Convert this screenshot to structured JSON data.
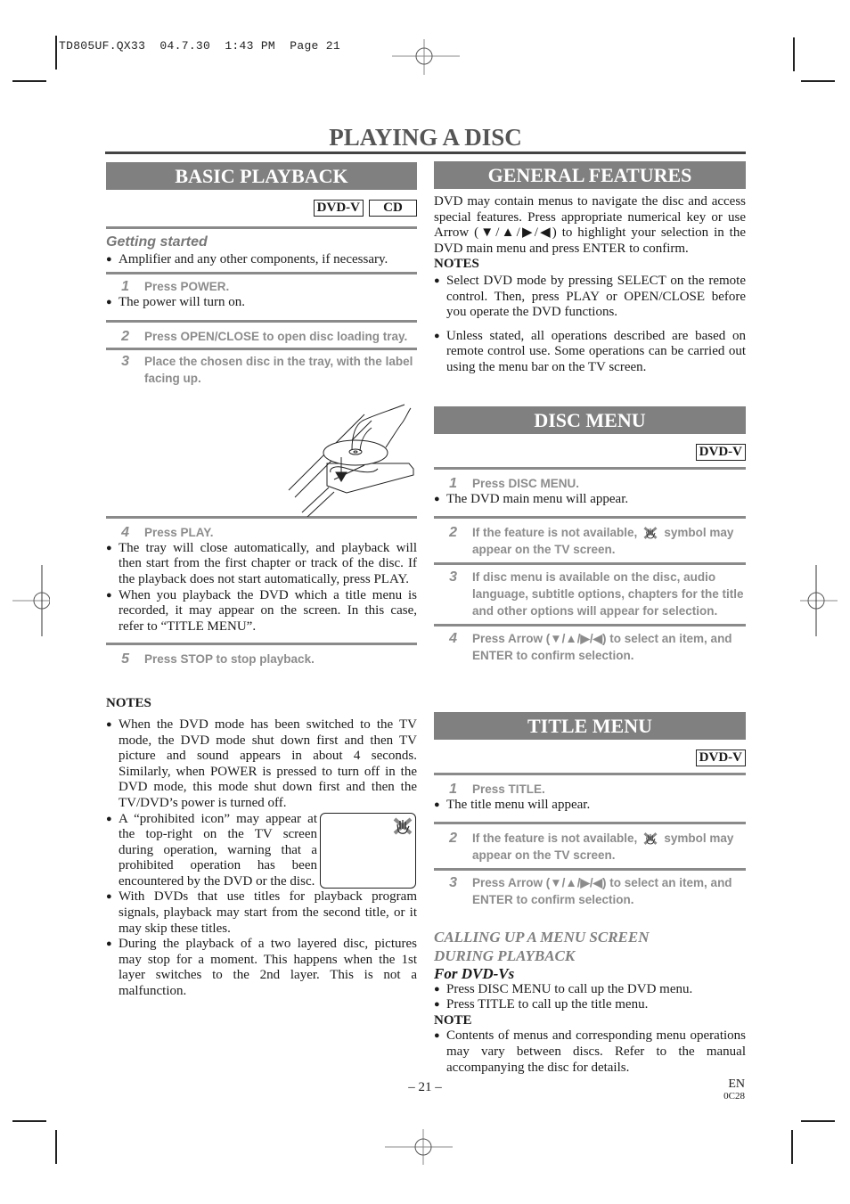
{
  "slug": "TD805UF.QX33  04.7.30  1:43 PM  Page 21",
  "page_title": "PLAYING A DISC",
  "basic_playback": {
    "heading": "BASIC PLAYBACK",
    "badges": [
      "DVD-V",
      "CD"
    ],
    "getting_started": "Getting started",
    "getting_bullet": "Amplifier and any other components, if necessary.",
    "steps": [
      {
        "num": "1",
        "text": "Press POWER.",
        "bullets": [
          "The power will turn on."
        ]
      },
      {
        "num": "2",
        "text": "Press OPEN/CLOSE to open disc loading tray.",
        "bullets": []
      },
      {
        "num": "3",
        "text": "Place the chosen disc in the tray, with the label facing up.",
        "bullets": []
      },
      {
        "num": "4",
        "text": "Press PLAY.",
        "bullets": [
          "The tray will close automatically, and playback will then start from the first chapter or track of the disc. If the playback does not start automatically, press PLAY.",
          "When you playback the DVD which a title menu is recorded, it may appear on the screen. In this case, refer to “TITLE MENU”."
        ]
      },
      {
        "num": "5",
        "text": "Press STOP to stop playback.",
        "bullets": []
      }
    ],
    "notes_heading": "NOTES",
    "notes": [
      "When the DVD mode has been switched to the TV mode, the DVD mode shut down first and then TV picture and sound appears in about 4 seconds. Similarly, when POWER is pressed to turn off in the DVD mode, this mode shut down first and then the TV/DVD’s power is turned off.",
      "A “prohibited icon” may appear at the top-right on the TV screen during operation, warning that a prohibited operation has been encountered by the DVD or the disc.",
      "With DVDs that use titles for playback program signals, playback may start from the second title, or it may skip these titles.",
      "During the playback of a two layered disc, pictures may stop for a moment. This happens when the 1st layer switches to the 2nd layer. This is not a malfunction."
    ]
  },
  "general_features": {
    "heading": "GENERAL FEATURES",
    "intro": "DVD may contain menus to navigate the disc and access special features. Press appropriate numerical key or use Arrow (▼/▲/▶/◀) to highlight your selection in the DVD main menu and press ENTER to confirm.",
    "notes_heading": "NOTES",
    "notes": [
      "Select DVD mode by pressing SELECT on the remote control. Then, press PLAY or OPEN/CLOSE before you operate the DVD functions.",
      "Unless stated, all operations described are based on remote control use. Some operations can be carried out using the menu bar on the TV screen."
    ]
  },
  "disc_menu": {
    "heading": "DISC MENU",
    "badges": [
      "DVD-V"
    ],
    "steps": [
      {
        "num": "1",
        "text": "Press DISC MENU.",
        "bullets": [
          "The DVD main menu will appear."
        ]
      },
      {
        "num": "2",
        "text_before": "If the feature is not available,",
        "text_after": "symbol may appear on the TV screen."
      },
      {
        "num": "3",
        "text": "If disc menu is available on the disc, audio language, subtitle options, chapters for the title and other options will appear for selection."
      },
      {
        "num": "4",
        "text": "Press Arrow (▼/▲/▶/◀) to select an item, and ENTER to confirm selection."
      }
    ]
  },
  "title_menu": {
    "heading": "TITLE MENU",
    "badges": [
      "DVD-V"
    ],
    "steps": [
      {
        "num": "1",
        "text": "Press TITLE.",
        "bullets": [
          "The title menu will appear."
        ]
      },
      {
        "num": "2",
        "text_before": "If the feature is not available,",
        "text_after": "symbol may appear on the TV screen."
      },
      {
        "num": "3",
        "text": "Press Arrow (▼/▲/▶/◀) to select an item, and ENTER to confirm selection."
      }
    ]
  },
  "calling_up": {
    "heading_line1": "CALLING UP A MENU SCREEN",
    "heading_line2": "DURING PLAYBACK",
    "subheading": "For DVD-Vs",
    "bullets": [
      "Press DISC MENU to call up the DVD menu.",
      "Press TITLE to call up the title menu."
    ],
    "note_heading": "NOTE",
    "note": "Contents of menus and corresponding menu operations may vary between discs. Refer to the manual accompanying the disc for details."
  },
  "footer": {
    "page_number": "– 21 –",
    "lang": "EN",
    "code": "0C28"
  },
  "icons": {
    "bullet": "●",
    "prohibited": "prohibited-hand-icon"
  }
}
